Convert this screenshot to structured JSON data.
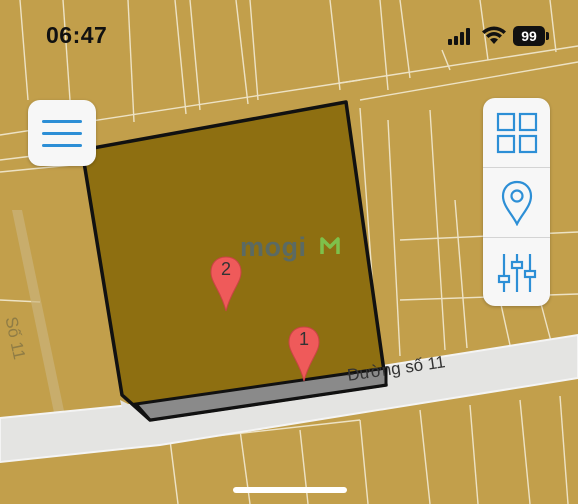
{
  "status_bar": {
    "time": "06:47",
    "battery": "99"
  },
  "map": {
    "watermark": "mogi",
    "roads": [
      {
        "label": "Đường số 11"
      },
      {
        "label": "Số 11"
      }
    ],
    "markers": [
      {
        "label": "1"
      },
      {
        "label": "2"
      }
    ],
    "colors": {
      "background": "#c29f4b",
      "parcel_fill": "#8e6f11",
      "parcel_border": "#111111",
      "road": "#e3e3e3",
      "marker": "#ef5a5a",
      "accent": "#2d8fd6"
    }
  },
  "controls": {
    "menu": {
      "icon": "hamburger-menu-icon"
    },
    "panel": [
      {
        "icon": "grid-icon"
      },
      {
        "icon": "location-pin-icon"
      },
      {
        "icon": "sliders-icon"
      }
    ]
  }
}
